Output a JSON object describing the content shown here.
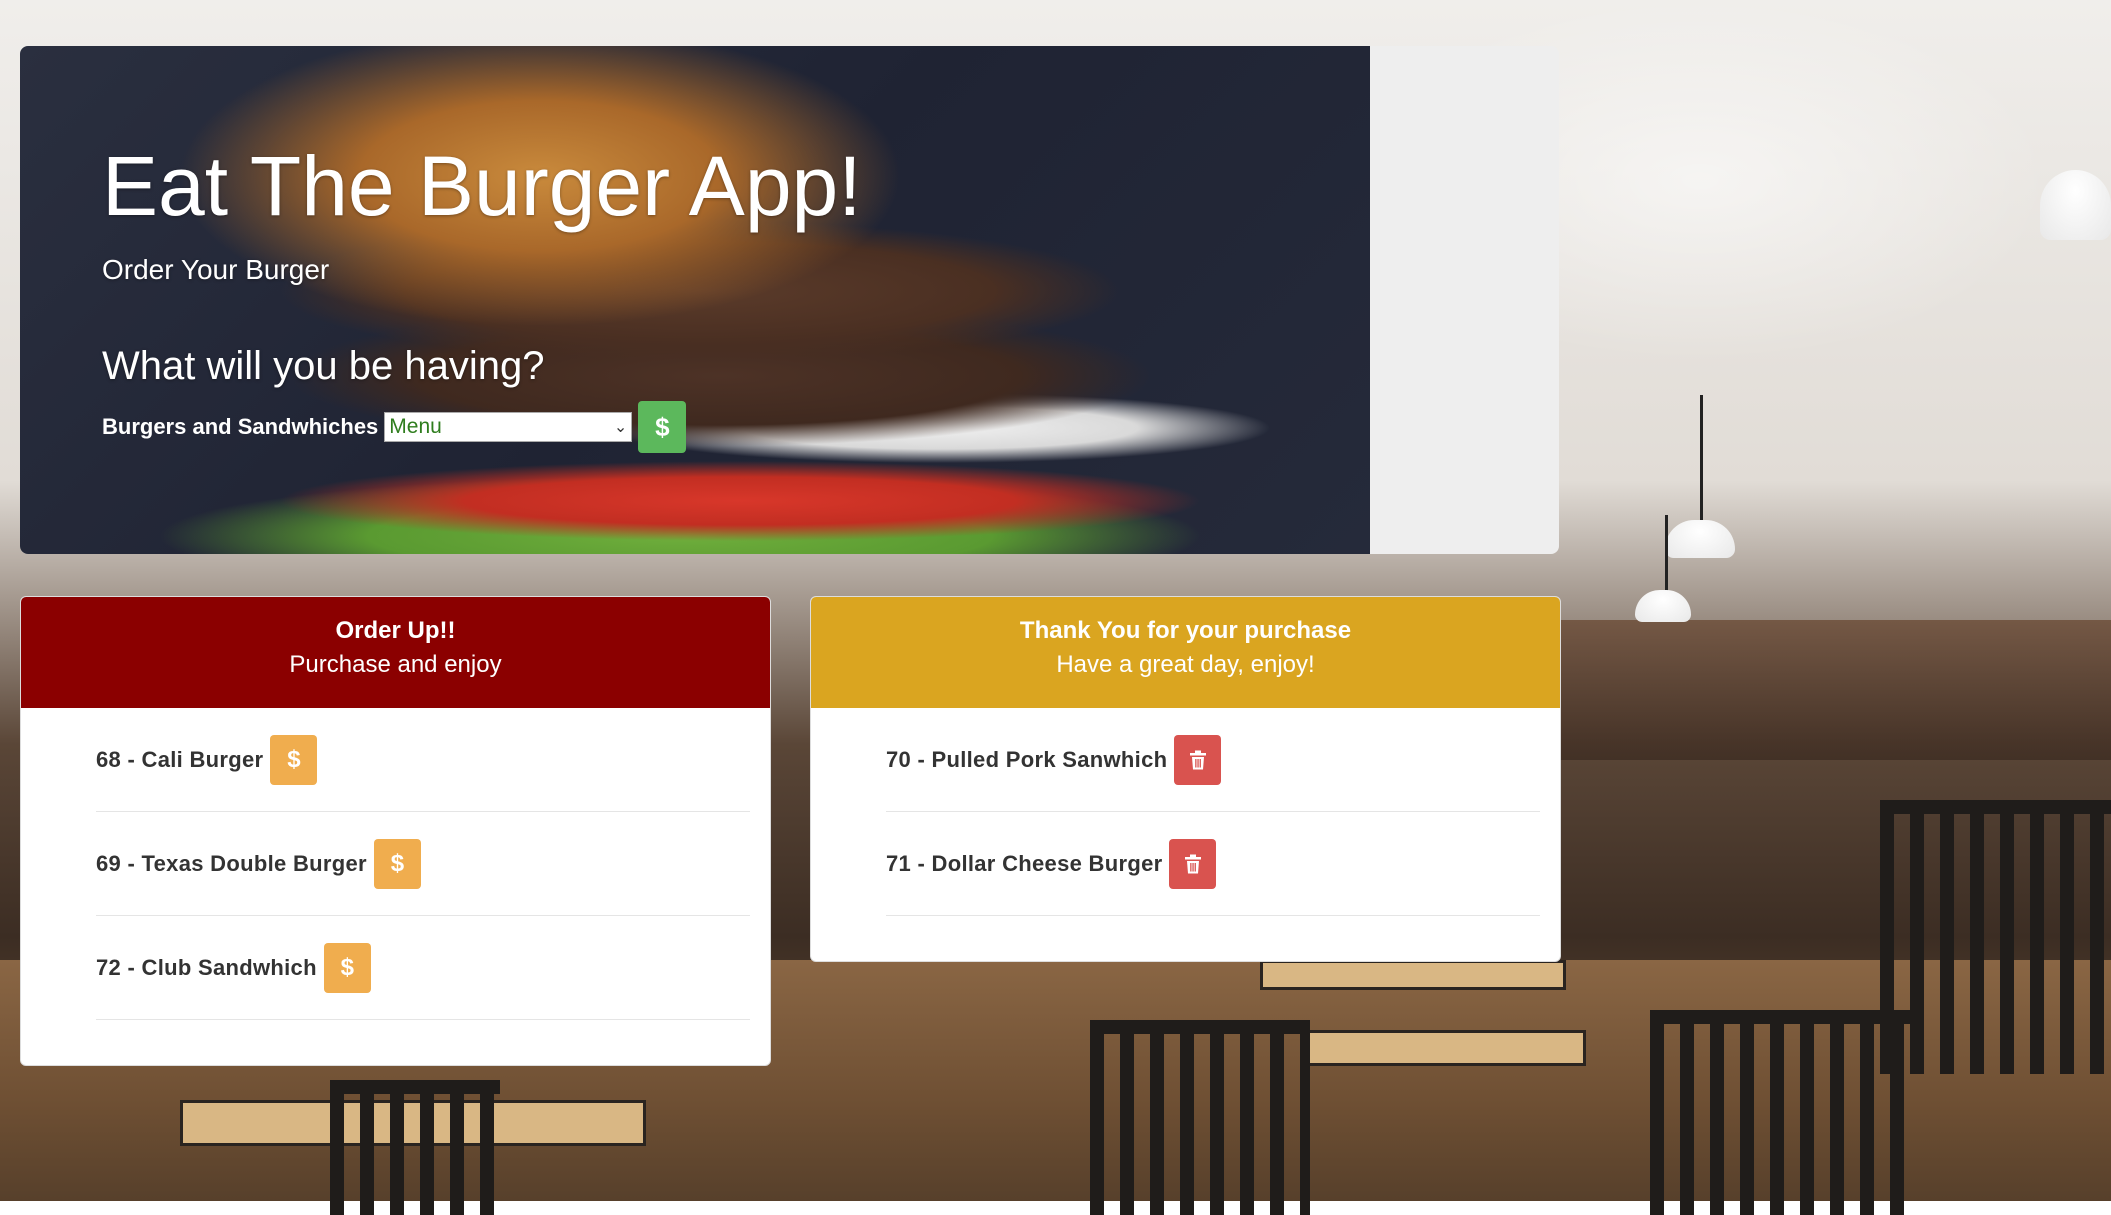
{
  "hero": {
    "title": "Eat The Burger App!",
    "subtitle": "Order Your Burger",
    "question": "What will you be having?",
    "form": {
      "label": "Burgers and Sandwhiches",
      "select_value": "Menu",
      "submit_icon": "dollar-icon"
    }
  },
  "order_card": {
    "title": "Order Up!!",
    "subtitle": "Purchase and enjoy",
    "header_color": "#8b0000",
    "items": [
      {
        "label": "68 - Cali Burger",
        "action_icon": "dollar-icon"
      },
      {
        "label": "69 - Texas Double Burger",
        "action_icon": "dollar-icon"
      },
      {
        "label": "72 - Club Sandwhich",
        "action_icon": "dollar-icon"
      }
    ]
  },
  "purchased_card": {
    "title": "Thank You for your purchase",
    "subtitle": "Have a great day, enjoy!",
    "header_color": "#daa520",
    "items": [
      {
        "label": "70 - Pulled Pork Sanwhich",
        "action_icon": "trash-icon"
      },
      {
        "label": "71 - Dollar Cheese Burger",
        "action_icon": "trash-icon"
      }
    ]
  },
  "colors": {
    "buy_button": "#f0ad4e",
    "delete_button": "#d9534f",
    "submit_button": "#5cb85c"
  },
  "glyphs": {
    "dollar": "$",
    "chevron": "⌄"
  }
}
